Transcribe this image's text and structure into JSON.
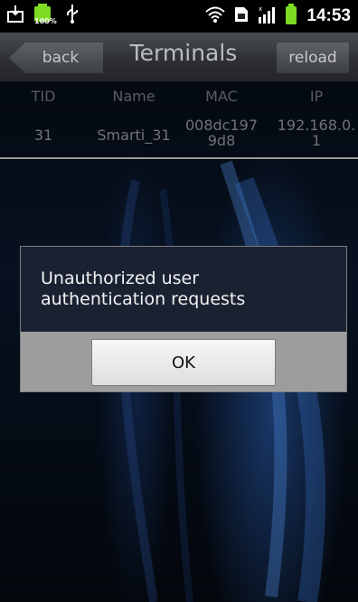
{
  "status_bar": {
    "icons": [
      "download-icon",
      "battery-100-icon",
      "usb-icon",
      "wifi-icon",
      "sim-icon",
      "signal-icon",
      "battery-icon"
    ],
    "battery_label": "100%",
    "time": "14:53"
  },
  "header": {
    "back_label": "back",
    "title": "Terminals",
    "reload_label": "reload"
  },
  "table": {
    "columns": [
      "TID",
      "Name",
      "MAC",
      "IP"
    ],
    "rows": [
      {
        "tid": "31",
        "name": "Smarti_31",
        "mac": "008dc1979d8",
        "ip": "192.168.0.1"
      }
    ]
  },
  "dialog": {
    "message": "Unauthorized user authentication requests",
    "ok_label": "OK"
  },
  "colors": {
    "status_bar_bg": "#000000",
    "title_bar": "#2e3034",
    "dialog_bg": "#1a2232",
    "dialog_footer": "#9d9d9d",
    "battery_green": "#7ddc22"
  }
}
